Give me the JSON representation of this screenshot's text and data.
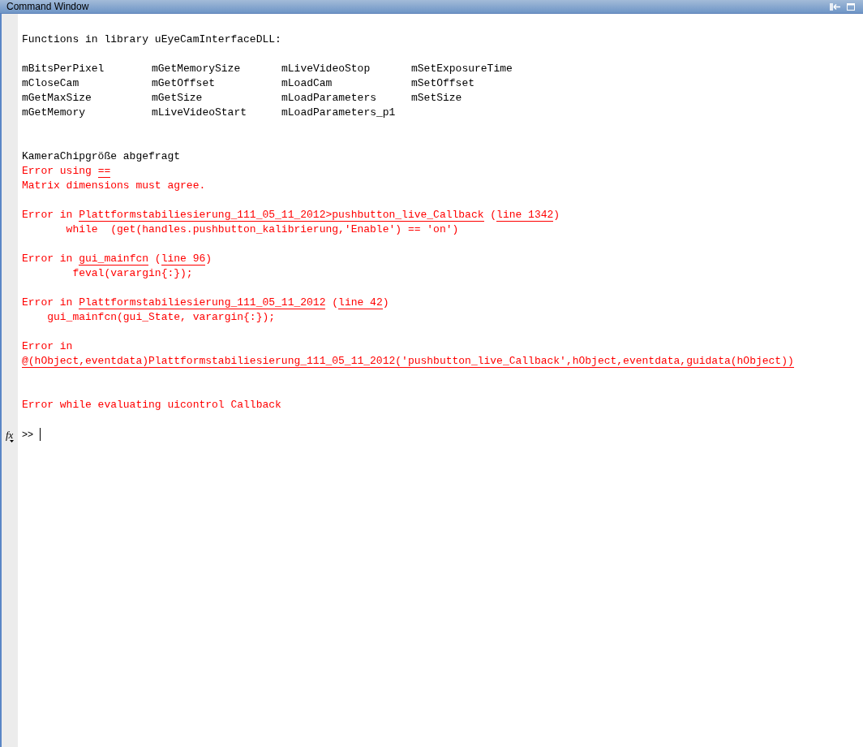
{
  "window": {
    "title": "Command Window"
  },
  "lines": [
    {
      "kind": "plain",
      "parts": [
        {
          "text": "Functions in library uEyeCamInterfaceDLL:",
          "link": false
        }
      ]
    },
    {
      "kind": "blank"
    },
    {
      "kind": "columns",
      "cells": [
        "mBitsPerPixel",
        "mGetMemorySize",
        "mLiveVideoStop",
        "mSetExposureTime"
      ]
    },
    {
      "kind": "columns",
      "cells": [
        "mCloseCam",
        "mGetOffset",
        "mLoadCam",
        "mSetOffset"
      ]
    },
    {
      "kind": "columns",
      "cells": [
        "mGetMaxSize",
        "mGetSize",
        "mLoadParameters",
        "mSetSize"
      ]
    },
    {
      "kind": "columns",
      "cells": [
        "mGetMemory",
        "mLiveVideoStart",
        "mLoadParameters_p1"
      ]
    },
    {
      "kind": "blank"
    },
    {
      "kind": "blank"
    },
    {
      "kind": "plain",
      "parts": [
        {
          "text": "KameraChipgröße abgefragt",
          "link": false
        }
      ]
    },
    {
      "kind": "error",
      "parts": [
        {
          "text": "Error using ",
          "link": false
        },
        {
          "text": "==",
          "link": true
        }
      ]
    },
    {
      "kind": "error",
      "parts": [
        {
          "text": "Matrix dimensions must agree.",
          "link": false
        }
      ]
    },
    {
      "kind": "blank"
    },
    {
      "kind": "error",
      "parts": [
        {
          "text": "Error in ",
          "link": false
        },
        {
          "text": "Plattformstabiliesierung_111_05_11_2012>pushbutton_live_Callback",
          "link": true
        },
        {
          "text": " (",
          "link": false
        },
        {
          "text": "line 1342",
          "link": true
        },
        {
          "text": ")",
          "link": false
        }
      ]
    },
    {
      "kind": "error",
      "parts": [
        {
          "text": "       while  (get(handles.pushbutton_kalibrierung,'Enable') == 'on')",
          "link": false
        }
      ]
    },
    {
      "kind": "blank"
    },
    {
      "kind": "error",
      "parts": [
        {
          "text": "Error in ",
          "link": false
        },
        {
          "text": "gui_mainfcn",
          "link": true
        },
        {
          "text": " (",
          "link": false
        },
        {
          "text": "line 96",
          "link": true
        },
        {
          "text": ")",
          "link": false
        }
      ]
    },
    {
      "kind": "error",
      "parts": [
        {
          "text": "        feval(varargin{:});",
          "link": false
        }
      ]
    },
    {
      "kind": "blank"
    },
    {
      "kind": "error",
      "parts": [
        {
          "text": "Error in ",
          "link": false
        },
        {
          "text": "Plattformstabiliesierung_111_05_11_2012",
          "link": true
        },
        {
          "text": " (",
          "link": false
        },
        {
          "text": "line 42",
          "link": true
        },
        {
          "text": ")",
          "link": false
        }
      ]
    },
    {
      "kind": "error",
      "parts": [
        {
          "text": "    gui_mainfcn(gui_State, varargin{:});",
          "link": false
        }
      ]
    },
    {
      "kind": "blank"
    },
    {
      "kind": "error",
      "parts": [
        {
          "text": "Error in",
          "link": false
        }
      ]
    },
    {
      "kind": "error",
      "parts": [
        {
          "text": "@(hObject,eventdata)Plattformstabiliesierung_111_05_11_2012('pushbutton_live_Callback',hObject,eventdata,guidata(hObject))",
          "link": true
        }
      ]
    },
    {
      "kind": "blank"
    },
    {
      "kind": "blank"
    },
    {
      "kind": "error",
      "parts": [
        {
          "text": "Error while evaluating uicontrol Callback",
          "link": false
        }
      ]
    },
    {
      "kind": "blank"
    }
  ],
  "prompt": {
    "icon": "fx",
    "symbol": ">>"
  }
}
